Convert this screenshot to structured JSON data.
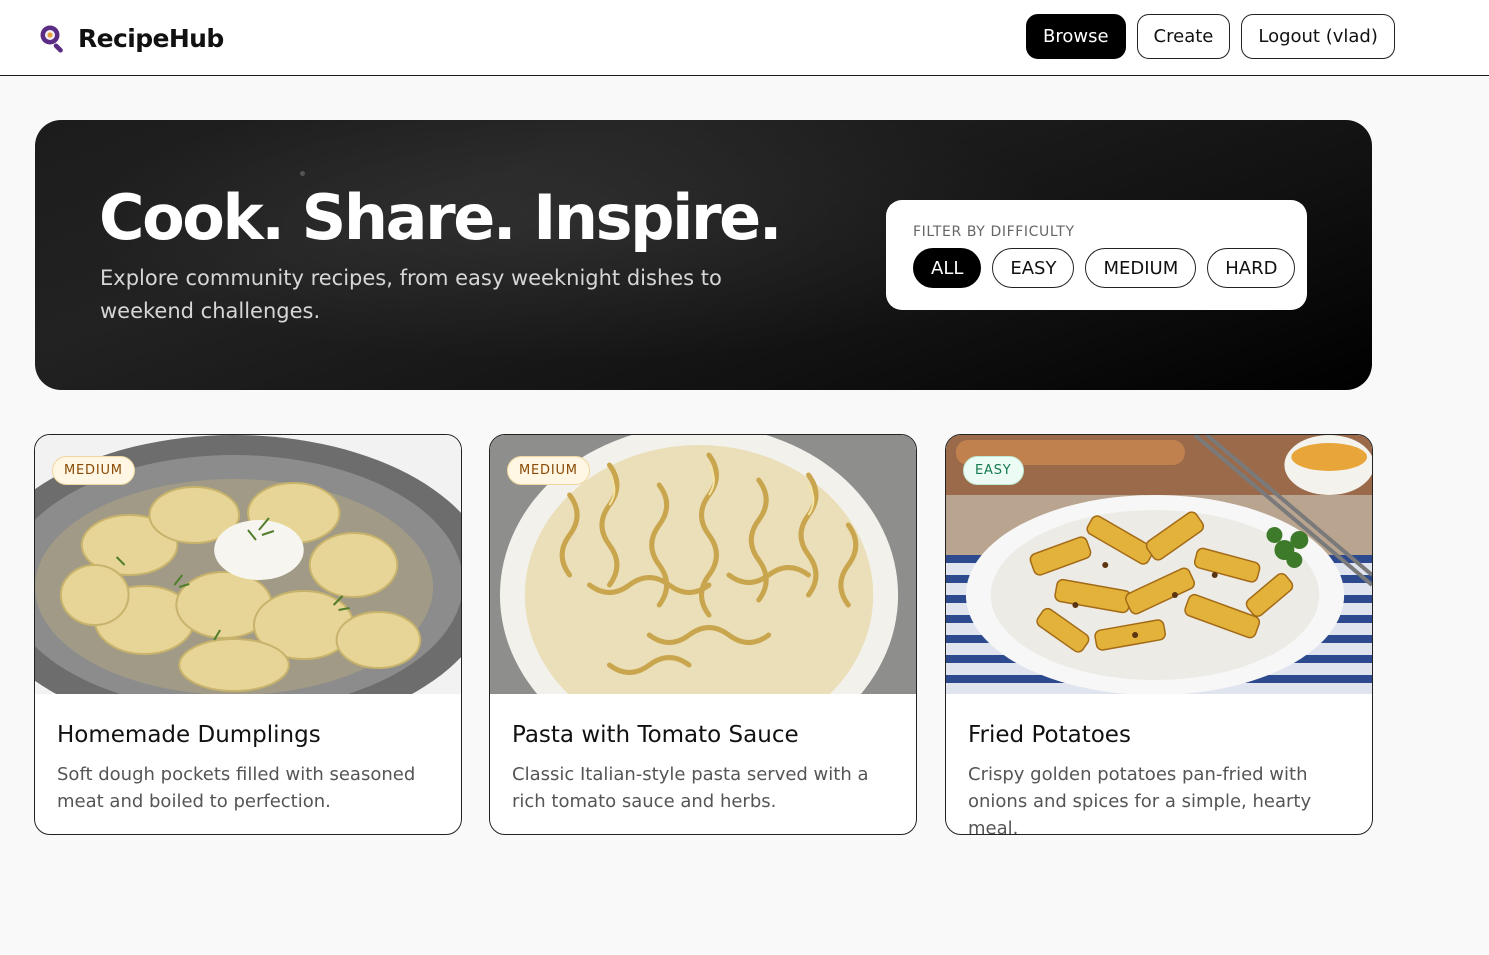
{
  "app": {
    "name": "RecipeHub"
  },
  "nav": {
    "browse": "Browse",
    "create": "Create",
    "logout": "Logout (vlad)"
  },
  "hero": {
    "title": "Cook. Share. Inspire.",
    "subtitle": "Explore community recipes, from easy weeknight dishes to weekend challenges."
  },
  "filter": {
    "label": "FILTER BY DIFFICULTY",
    "options": [
      "ALL",
      "EASY",
      "MEDIUM",
      "HARD"
    ],
    "selected": "ALL"
  },
  "recipes": [
    {
      "badge": "MEDIUM",
      "title": "Homemade Dumplings",
      "description": "Soft dough pockets filled with seasoned meat and boiled to perfection.",
      "image": "dumplings-photo"
    },
    {
      "badge": "MEDIUM",
      "title": "Pasta with Tomato Sauce",
      "description": "Classic Italian-style pasta served with a rich tomato sauce and herbs.",
      "image": "pasta-photo"
    },
    {
      "badge": "EASY",
      "title": "Fried Potatoes",
      "description": "Crispy golden potatoes pan-fried with onions and spices for a simple, hearty meal.",
      "image": "potatoes-photo"
    }
  ],
  "colors": {
    "accent": "#000000",
    "medium_badge": "#8a4a06",
    "easy_badge": "#137a4f",
    "logo": "#5b2c83"
  }
}
